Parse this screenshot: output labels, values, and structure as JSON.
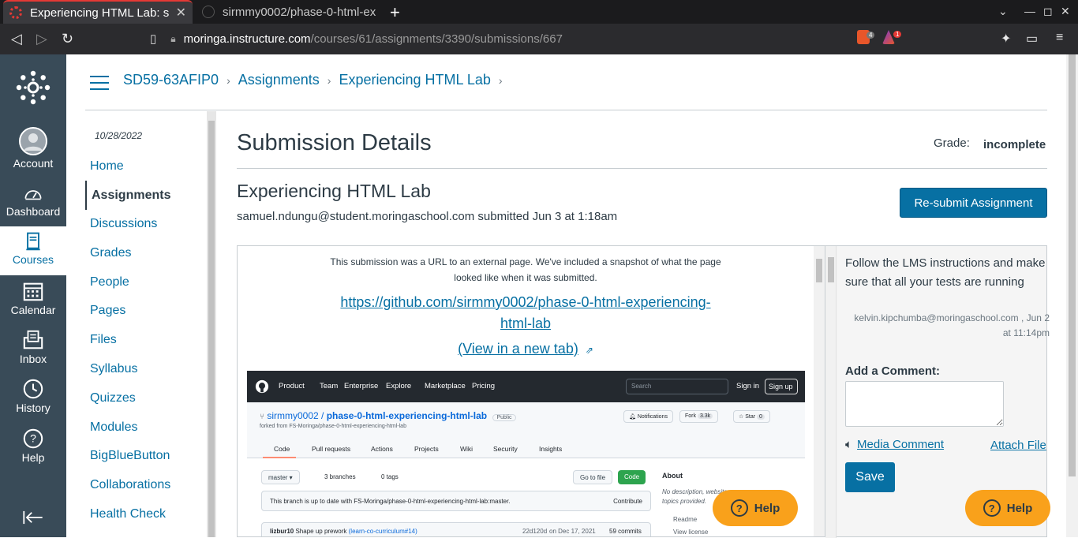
{
  "browser": {
    "tabs": [
      {
        "title": "Experiencing HTML Lab: s",
        "active": true
      },
      {
        "title": "sirmmy0002/phase-0-html-exp",
        "active": false
      }
    ],
    "new_tab": "+",
    "url_host": "moringa.instructure.com",
    "url_path": "/courses/61/assignments/3390/submissions/667",
    "shield_count": "4",
    "rewards_count": "1"
  },
  "global_nav": {
    "items": [
      {
        "label": "Account",
        "icon": "avatar-icon"
      },
      {
        "label": "Dashboard",
        "icon": "dashboard-icon"
      },
      {
        "label": "Courses",
        "icon": "courses-icon",
        "active": true
      },
      {
        "label": "Calendar",
        "icon": "calendar-icon"
      },
      {
        "label": "Inbox",
        "icon": "inbox-icon"
      },
      {
        "label": "History",
        "icon": "history-icon"
      },
      {
        "label": "Help",
        "icon": "help-icon"
      }
    ]
  },
  "breadcrumbs": [
    "SD59-63AFIP0",
    "Assignments",
    "Experiencing HTML Lab"
  ],
  "course_nav": {
    "date": "10/28/2022",
    "items": [
      "Home",
      "Assignments",
      "Discussions",
      "Grades",
      "People",
      "Pages",
      "Files",
      "Syllabus",
      "Quizzes",
      "Modules",
      "BigBlueButton",
      "Collaborations",
      "Health Check"
    ],
    "active": "Assignments"
  },
  "submission": {
    "title": "Submission Details",
    "grade_label": "Grade:",
    "grade_value": "incomplete",
    "assignment_name": "Experiencing HTML Lab",
    "submitted_line": "samuel.ndungu@student.moringaschool.com submitted Jun 3 at 1:18am",
    "resubmit_label": "Re-submit Assignment"
  },
  "preview": {
    "note": "This submission was a URL to an external page. We've included a snapshot of what the page looked like when it was submitted.",
    "link": "https://github.com/sirmmy0002/phase-0-html-experiencing-html-lab",
    "view_new_tab": "(View in a new tab)"
  },
  "github_snapshot": {
    "nav": [
      "Product",
      "Team",
      "Enterprise",
      "Explore",
      "Marketplace",
      "Pricing"
    ],
    "search_placeholder": "Search",
    "signin": "Sign in",
    "signup": "Sign up",
    "owner": "sirmmy0002",
    "repo": "phase-0-html-experiencing-html-lab",
    "visibility": "Public",
    "forked_from": "forked from FS-Moringa/phase-0-html-experiencing-html-lab",
    "notifications": "Notifications",
    "fork": "Fork",
    "fork_count": "3.3k",
    "star": "Star",
    "star_count": "0",
    "tabs": [
      "Code",
      "Pull requests",
      "Actions",
      "Projects",
      "Wiki",
      "Security",
      "Insights"
    ],
    "branch": "master",
    "branches": "3 branches",
    "tags": "0 tags",
    "goto_file": "Go to file",
    "code_btn": "Code",
    "up_to_date": "This branch is up to date with FS-Moringa/phase-0-html-experiencing-html-lab:master.",
    "contribute": "Contribute",
    "commit_author": "lizbur10",
    "commit_msg": "Shape up prework",
    "commit_ref": "(learn-co-curriculum#14)",
    "commit_hash": "22d120d",
    "commit_date": "on Dec 17, 2021",
    "commits": "59 commits",
    "about": "About",
    "about_desc": "No description, website, or topics provided.",
    "readme": "Readme",
    "license": "View license"
  },
  "comments": {
    "text": "Follow the LMS instructions and make sure that all your tests are running",
    "author": "kelvin.kipchumba@moringaschool.com , Jun 2 at 11:14pm",
    "add_label": "Add a Comment:",
    "media_label": "Media Comment",
    "attach_label": "Attach File",
    "save_label": "Save"
  },
  "help_label": "Help",
  "colors": {
    "rail": "#394b58",
    "link": "#0770a3",
    "help": "#f9a11b"
  }
}
